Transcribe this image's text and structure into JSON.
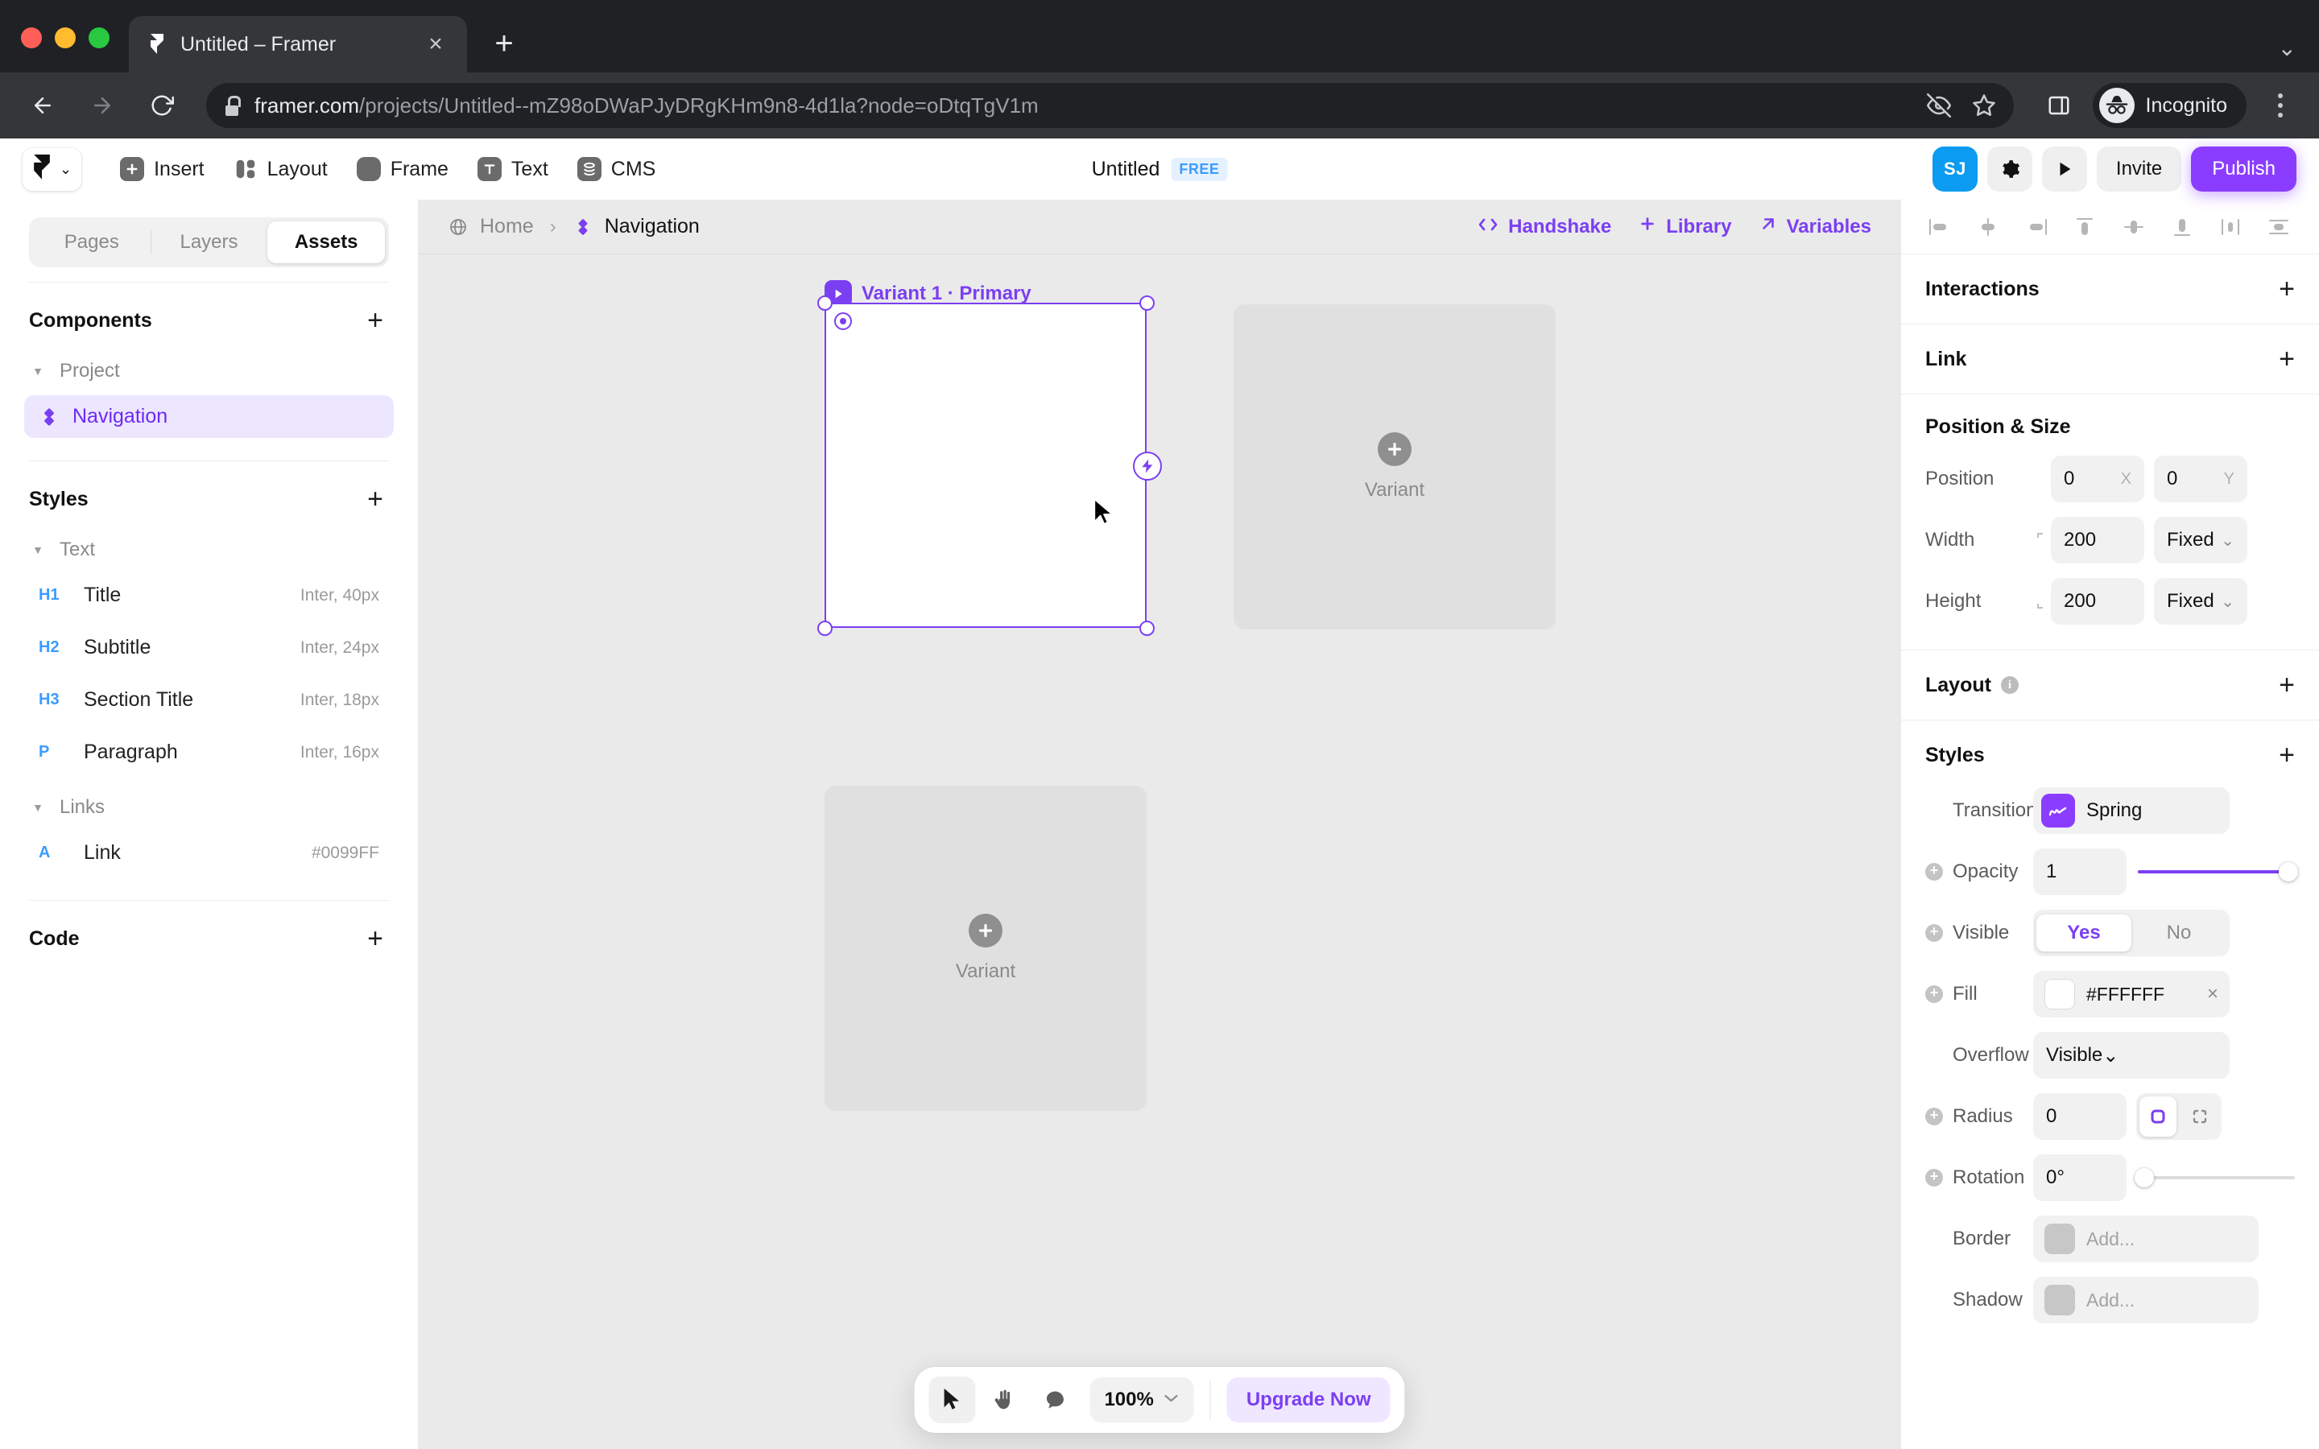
{
  "browser": {
    "tab": {
      "title": "Untitled – Framer",
      "favicon_icon": "framer-favicon",
      "close_icon": "close-icon"
    },
    "new_tab_icon": "plus-icon",
    "tabstrip_chevron_icon": "chevron-down-icon",
    "nav": {
      "back_icon": "arrow-left-icon",
      "forward_icon": "arrow-right-icon",
      "reload_icon": "reload-icon"
    },
    "omnibox": {
      "lock_icon": "lock-icon",
      "url_domain": "framer.com",
      "url_path": "/projects/Untitled--mZ98oDWaPJyDRgKHm9n8-4d1la?node=oDtqTgV1m",
      "hide_icon": "eye-slash-icon",
      "bookmark_icon": "star-icon"
    },
    "side_panel_icon": "side-panel-icon",
    "profile": {
      "label": "Incognito",
      "icon": "incognito-icon"
    },
    "menu_icon": "kebab-menu-icon"
  },
  "toolbar": {
    "logo_icon": "framer-logo",
    "logo_chevron_icon": "chevron-down-icon",
    "items": [
      {
        "label": "Insert",
        "icon": "plus-square-icon"
      },
      {
        "label": "Layout",
        "icon": "layout-icon"
      },
      {
        "label": "Frame",
        "icon": "frame-icon"
      },
      {
        "label": "Text",
        "icon": "text-icon"
      },
      {
        "label": "CMS",
        "icon": "cms-database-icon"
      }
    ],
    "project_title": "Untitled",
    "plan_badge": "FREE",
    "avatar_initials": "SJ",
    "settings_icon": "gear-icon",
    "preview_icon": "play-icon",
    "invite_label": "Invite",
    "publish_label": "Publish"
  },
  "left_panel": {
    "tabs": [
      {
        "label": "Pages",
        "active": false
      },
      {
        "label": "Layers",
        "active": false
      },
      {
        "label": "Assets",
        "active": true
      }
    ],
    "components": {
      "title": "Components",
      "add_icon": "plus-icon",
      "group": {
        "label": "Project",
        "caret_icon": "caret-down-icon"
      },
      "items": [
        {
          "label": "Navigation",
          "icon": "component-icon",
          "selected": true
        }
      ]
    },
    "styles": {
      "title": "Styles",
      "add_icon": "plus-icon",
      "groups": [
        {
          "label": "Text",
          "caret_icon": "caret-down-icon",
          "items": [
            {
              "tag": "H1",
              "label": "Title",
              "meta": "Inter, 40px"
            },
            {
              "tag": "H2",
              "label": "Subtitle",
              "meta": "Inter, 24px"
            },
            {
              "tag": "H3",
              "label": "Section Title",
              "meta": "Inter, 18px"
            },
            {
              "tag": "P",
              "label": "Paragraph",
              "meta": "Inter, 16px"
            }
          ]
        },
        {
          "label": "Links",
          "caret_icon": "caret-down-icon",
          "items": [
            {
              "tag": "A",
              "label": "Link",
              "meta": "#0099FF"
            }
          ]
        }
      ]
    },
    "code": {
      "title": "Code",
      "add_icon": "plus-icon"
    }
  },
  "canvas_header": {
    "breadcrumb": {
      "home_icon": "globe-icon",
      "home_label": "Home",
      "separator": "›",
      "current_icon": "component-icon",
      "current_label": "Navigation"
    },
    "actions": [
      {
        "label": "Handshake",
        "icon": "code-brackets-icon"
      },
      {
        "label": "Library",
        "icon": "plus-icon"
      },
      {
        "label": "Variables",
        "icon": "arrow-up-right-icon"
      }
    ]
  },
  "canvas": {
    "selection": {
      "label": "Variant 1 · Primary",
      "play_icon": "play-icon",
      "bolt_icon": "lightning-bolt-icon",
      "radius_handle_icon": "radius-handle-icon"
    },
    "variant_placeholders": [
      {
        "label": "Variant",
        "icon": "plus-circle-icon"
      },
      {
        "label": "Variant",
        "icon": "plus-circle-icon"
      }
    ],
    "cursor_icon": "arrow-cursor-icon"
  },
  "bottom_bar": {
    "tools": [
      {
        "icon": "arrow-cursor-icon",
        "active": true
      },
      {
        "icon": "hand-icon",
        "active": false
      },
      {
        "icon": "comment-icon",
        "active": false
      }
    ],
    "zoom_value": "100%",
    "zoom_chevron_icon": "chevron-down-icon",
    "upgrade_label": "Upgrade Now"
  },
  "right_panel": {
    "align_icons": [
      "align-left-icon",
      "align-center-horizontal-icon",
      "align-right-icon",
      "align-top-icon",
      "align-center-vertical-icon",
      "align-bottom-icon",
      "distribute-horizontal-icon",
      "distribute-vertical-icon"
    ],
    "sections": {
      "interactions": {
        "title": "Interactions",
        "add_icon": "plus-icon"
      },
      "link": {
        "title": "Link",
        "add_icon": "plus-icon"
      },
      "position_size": {
        "title": "Position & Size",
        "position": {
          "label": "Position",
          "x": "0",
          "x_suffix": "X",
          "y": "0",
          "y_suffix": "Y"
        },
        "width": {
          "label": "Width",
          "value": "200",
          "mode": "Fixed"
        },
        "height": {
          "label": "Height",
          "value": "200",
          "mode": "Fixed"
        },
        "link_icon": "link-dimensions-icon",
        "chevron_icon": "chevron-down-icon"
      },
      "layout": {
        "title": "Layout",
        "info_icon": "info-icon",
        "add_icon": "plus-icon"
      },
      "styles": {
        "title": "Styles",
        "add_icon": "plus-icon",
        "transition": {
          "label": "Transition",
          "value": "Spring",
          "icon": "spring-curve-icon"
        },
        "opacity": {
          "label": "Opacity",
          "value": "1",
          "slider_percent": 100,
          "add_icon": "plus-circle-icon"
        },
        "visible": {
          "label": "Visible",
          "yes": "Yes",
          "no": "No",
          "selected": "Yes",
          "add_icon": "plus-circle-icon"
        },
        "fill": {
          "label": "Fill",
          "value": "#FFFFFF",
          "swatch": "#FFFFFF",
          "clear_icon": "close-icon",
          "add_icon": "plus-circle-icon"
        },
        "overflow": {
          "label": "Overflow",
          "value": "Visible",
          "chevron_icon": "chevron-down-icon"
        },
        "radius": {
          "label": "Radius",
          "value": "0",
          "mode_icons": [
            "rounded-square-icon",
            "corners-individual-icon"
          ],
          "selected_mode": 0,
          "add_icon": "plus-circle-icon"
        },
        "rotation": {
          "label": "Rotation",
          "value": "0°",
          "slider_percent": 0,
          "add_icon": "plus-circle-icon"
        },
        "border": {
          "label": "Border",
          "placeholder": "Add...",
          "swatch": "#C7C7C7"
        },
        "shadow": {
          "label": "Shadow",
          "placeholder": "Add...",
          "swatch": "#C7C7C7"
        }
      }
    }
  },
  "colors": {
    "framer_purple": "#7B3FF2",
    "publish_purple": "#8B3DFF",
    "accent_blue": "#0B9BF1",
    "link_blue": "#0099FF",
    "canvas_bg": "#EAEAEA"
  }
}
